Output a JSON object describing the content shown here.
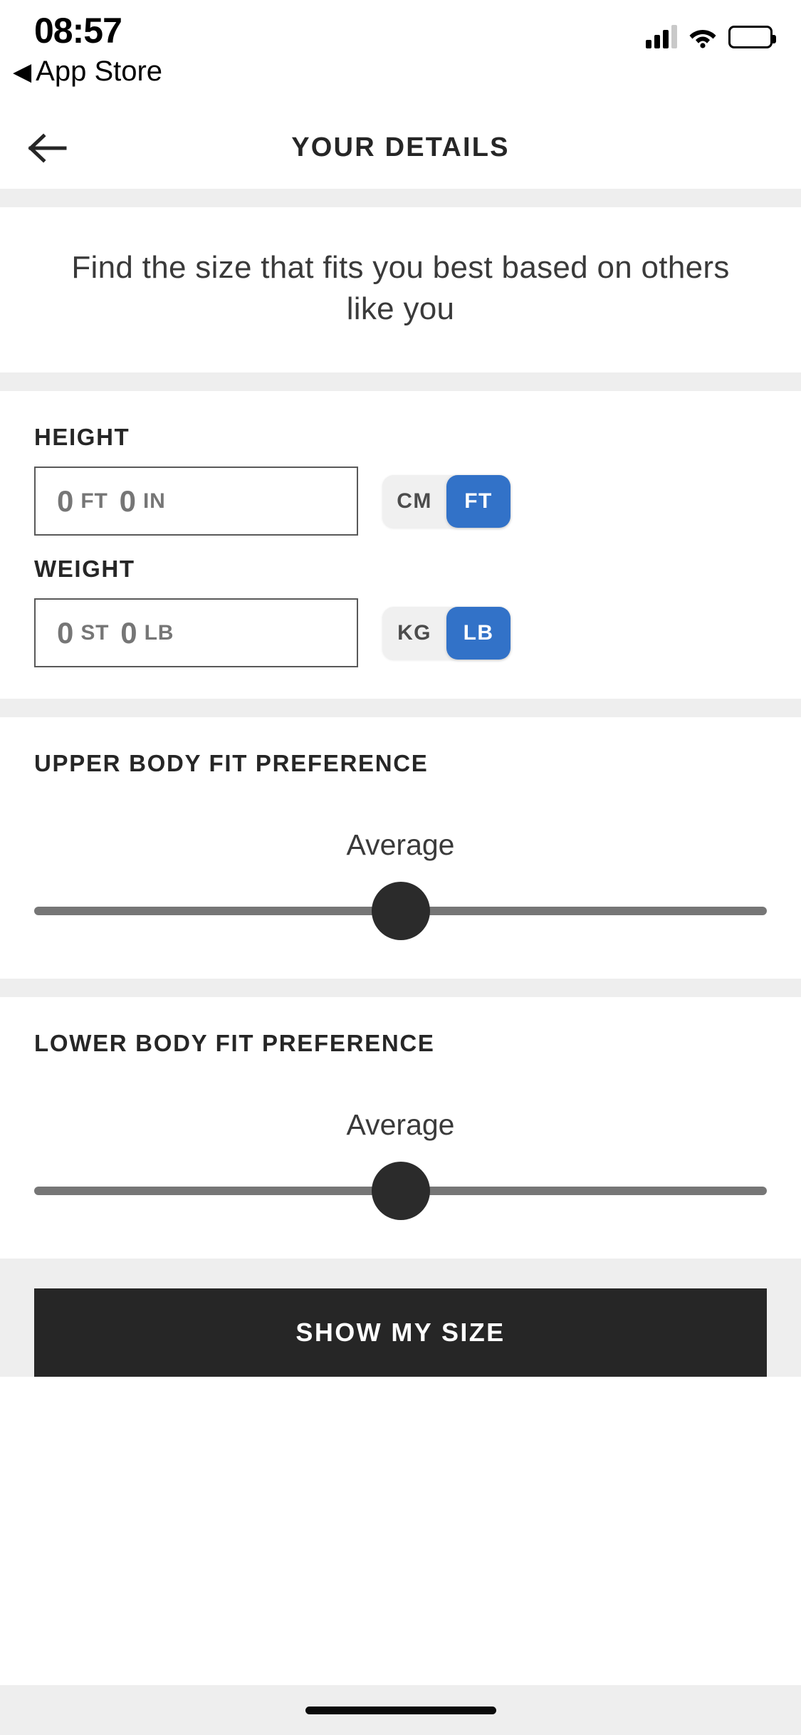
{
  "status_bar": {
    "time": "08:57",
    "back_app_label": "App Store",
    "back_triangle": "◀",
    "icons": [
      "cellular-signal-icon",
      "wifi-icon",
      "battery-icon"
    ]
  },
  "header": {
    "title": "YOUR DETAILS",
    "back_icon": "arrow-left-icon"
  },
  "intro": {
    "text": "Find the size that fits you best based on others like you"
  },
  "height": {
    "label": "HEIGHT",
    "value_primary": "0",
    "unit_primary": "FT",
    "value_secondary": "0",
    "unit_secondary": "IN",
    "toggle": {
      "options": [
        "CM",
        "FT"
      ],
      "selected": "FT",
      "active_color": "#3272c8",
      "inactive_bg": "#f0f0f0"
    }
  },
  "weight": {
    "label": "WEIGHT",
    "value_primary": "0",
    "unit_primary": "ST",
    "value_secondary": "0",
    "unit_secondary": "LB",
    "toggle": {
      "options": [
        "KG",
        "LB"
      ],
      "selected": "LB",
      "active_color": "#3272c8",
      "inactive_bg": "#f0f0f0"
    }
  },
  "upper_body_fit": {
    "title": "UPPER BODY FIT PREFERENCE",
    "value_label": "Average",
    "slider_percent": 50
  },
  "lower_body_fit": {
    "title": "LOWER BODY FIT PREFERENCE",
    "value_label": "Average",
    "slider_percent": 50
  },
  "cta": {
    "label": "SHOW MY SIZE"
  },
  "colors": {
    "accent_blue": "#3272c8",
    "dark": "#262626",
    "band_gray": "#eeeeee",
    "muted_text": "#767676"
  }
}
